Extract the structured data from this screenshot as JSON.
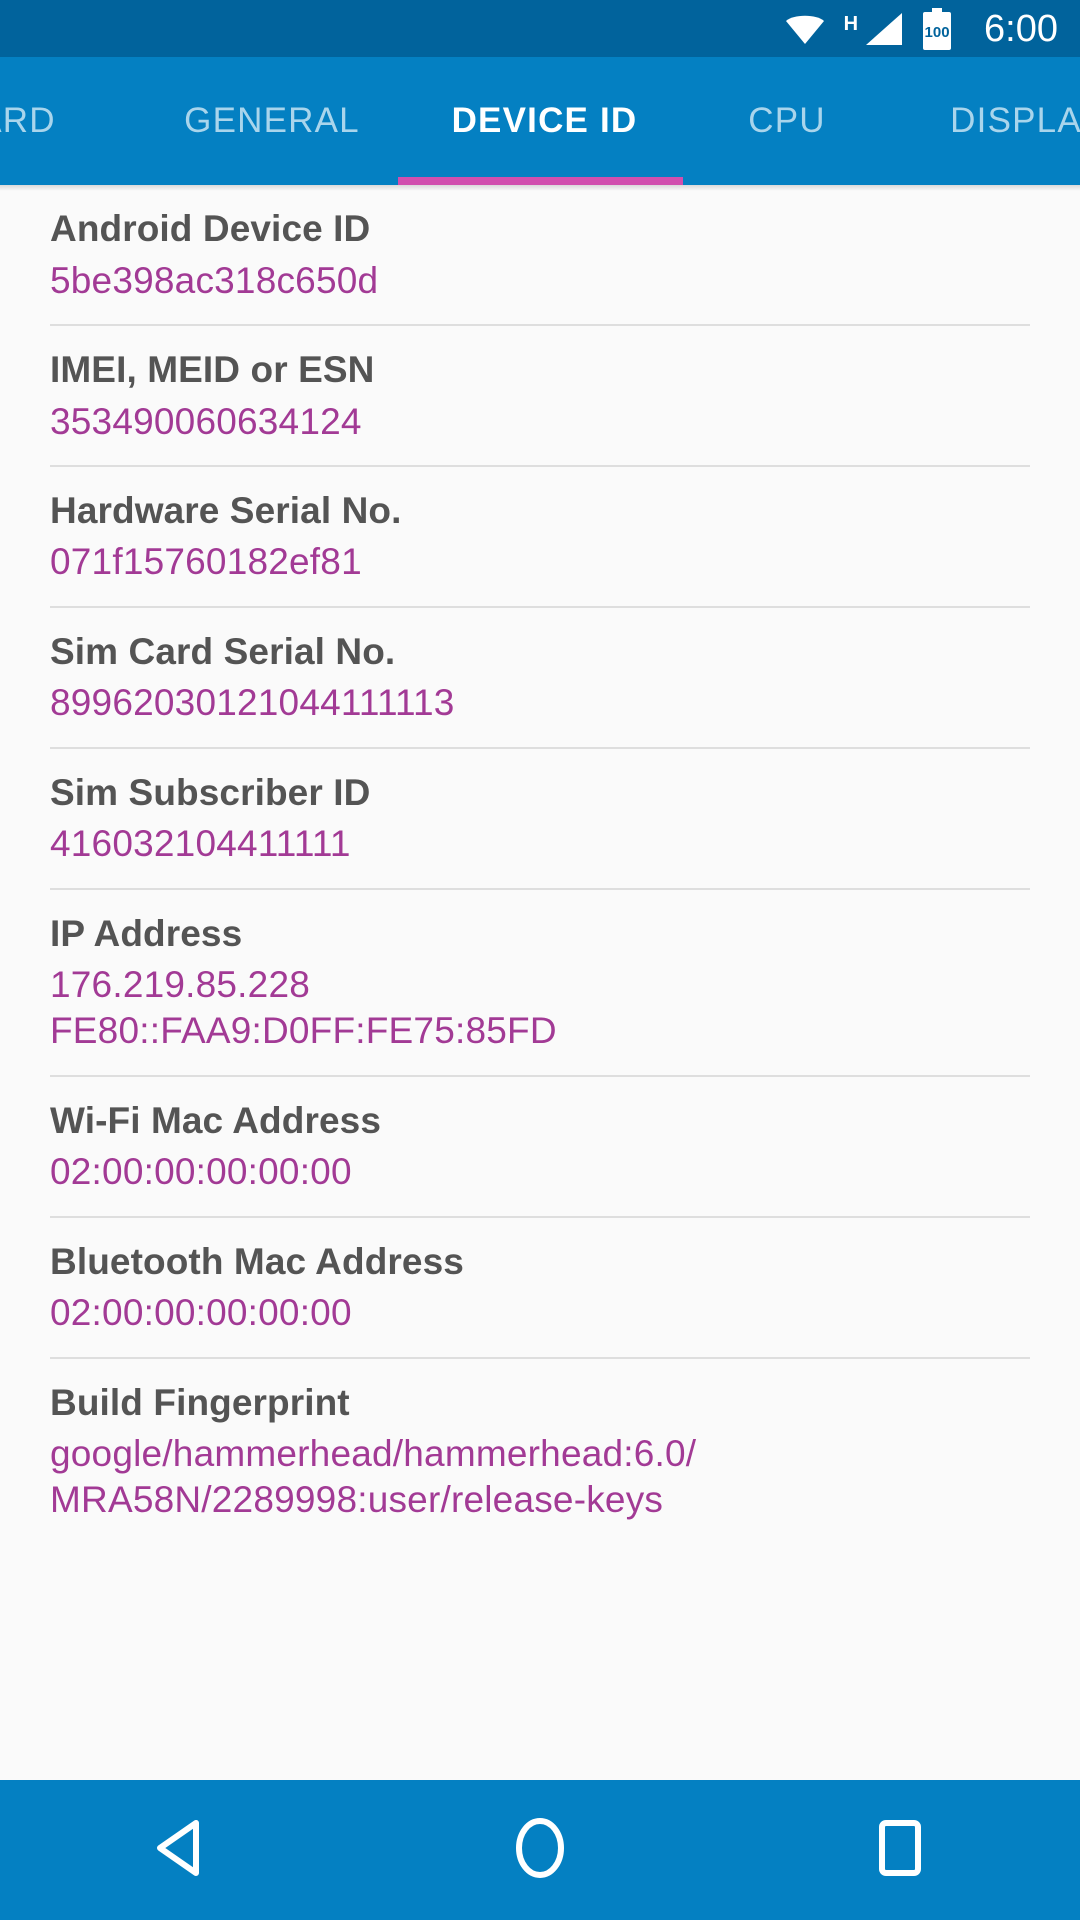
{
  "status_bar": {
    "icons": [
      "wifi-icon",
      "network-type-h",
      "cellular-signal-icon",
      "battery-icon"
    ],
    "network_type": "H",
    "battery_level": "100",
    "time": "6:00"
  },
  "tabs": {
    "items": [
      {
        "label": "ARD",
        "active": false
      },
      {
        "label": "GENERAL",
        "active": false
      },
      {
        "label": "DEVICE ID",
        "active": true
      },
      {
        "label": "CPU",
        "active": false
      },
      {
        "label": "DISPLAY",
        "active": false
      }
    ],
    "indicator_color": "#d14fae",
    "active_tab": "DEVICE ID"
  },
  "list": {
    "rows": [
      {
        "label": "Android Device ID",
        "values": [
          "5be398ac318c650d"
        ]
      },
      {
        "label": "IMEI, MEID or ESN",
        "values": [
          "353490060634124"
        ]
      },
      {
        "label": "Hardware Serial No.",
        "values": [
          "071f15760182ef81"
        ]
      },
      {
        "label": "Sim Card Serial No.",
        "values": [
          "89962030121044111113"
        ]
      },
      {
        "label": "Sim Subscriber ID",
        "values": [
          "416032104411111"
        ]
      },
      {
        "label": "IP Address",
        "values": [
          "176.219.85.228",
          "FE80::FAA9:D0FF:FE75:85FD"
        ]
      },
      {
        "label": "Wi-Fi Mac Address",
        "values": [
          "02:00:00:00:00:00"
        ]
      },
      {
        "label": "Bluetooth Mac Address",
        "values": [
          "02:00:00:00:00:00"
        ]
      },
      {
        "label": "Build Fingerprint",
        "values": [
          "google/hammerhead/hammerhead:6.0/",
          "MRA58N/2289998:user/release-keys"
        ]
      }
    ]
  },
  "nav_bar": {
    "buttons": [
      {
        "name": "back-icon"
      },
      {
        "name": "home-icon"
      },
      {
        "name": "recents-icon"
      }
    ]
  },
  "colors": {
    "status_bar_bg": "#01639c",
    "tab_bar_bg": "#0480c2",
    "accent_pink": "#d14fae",
    "value_text": "#a23a95",
    "label_text": "#545454",
    "content_bg": "#fafafa"
  }
}
